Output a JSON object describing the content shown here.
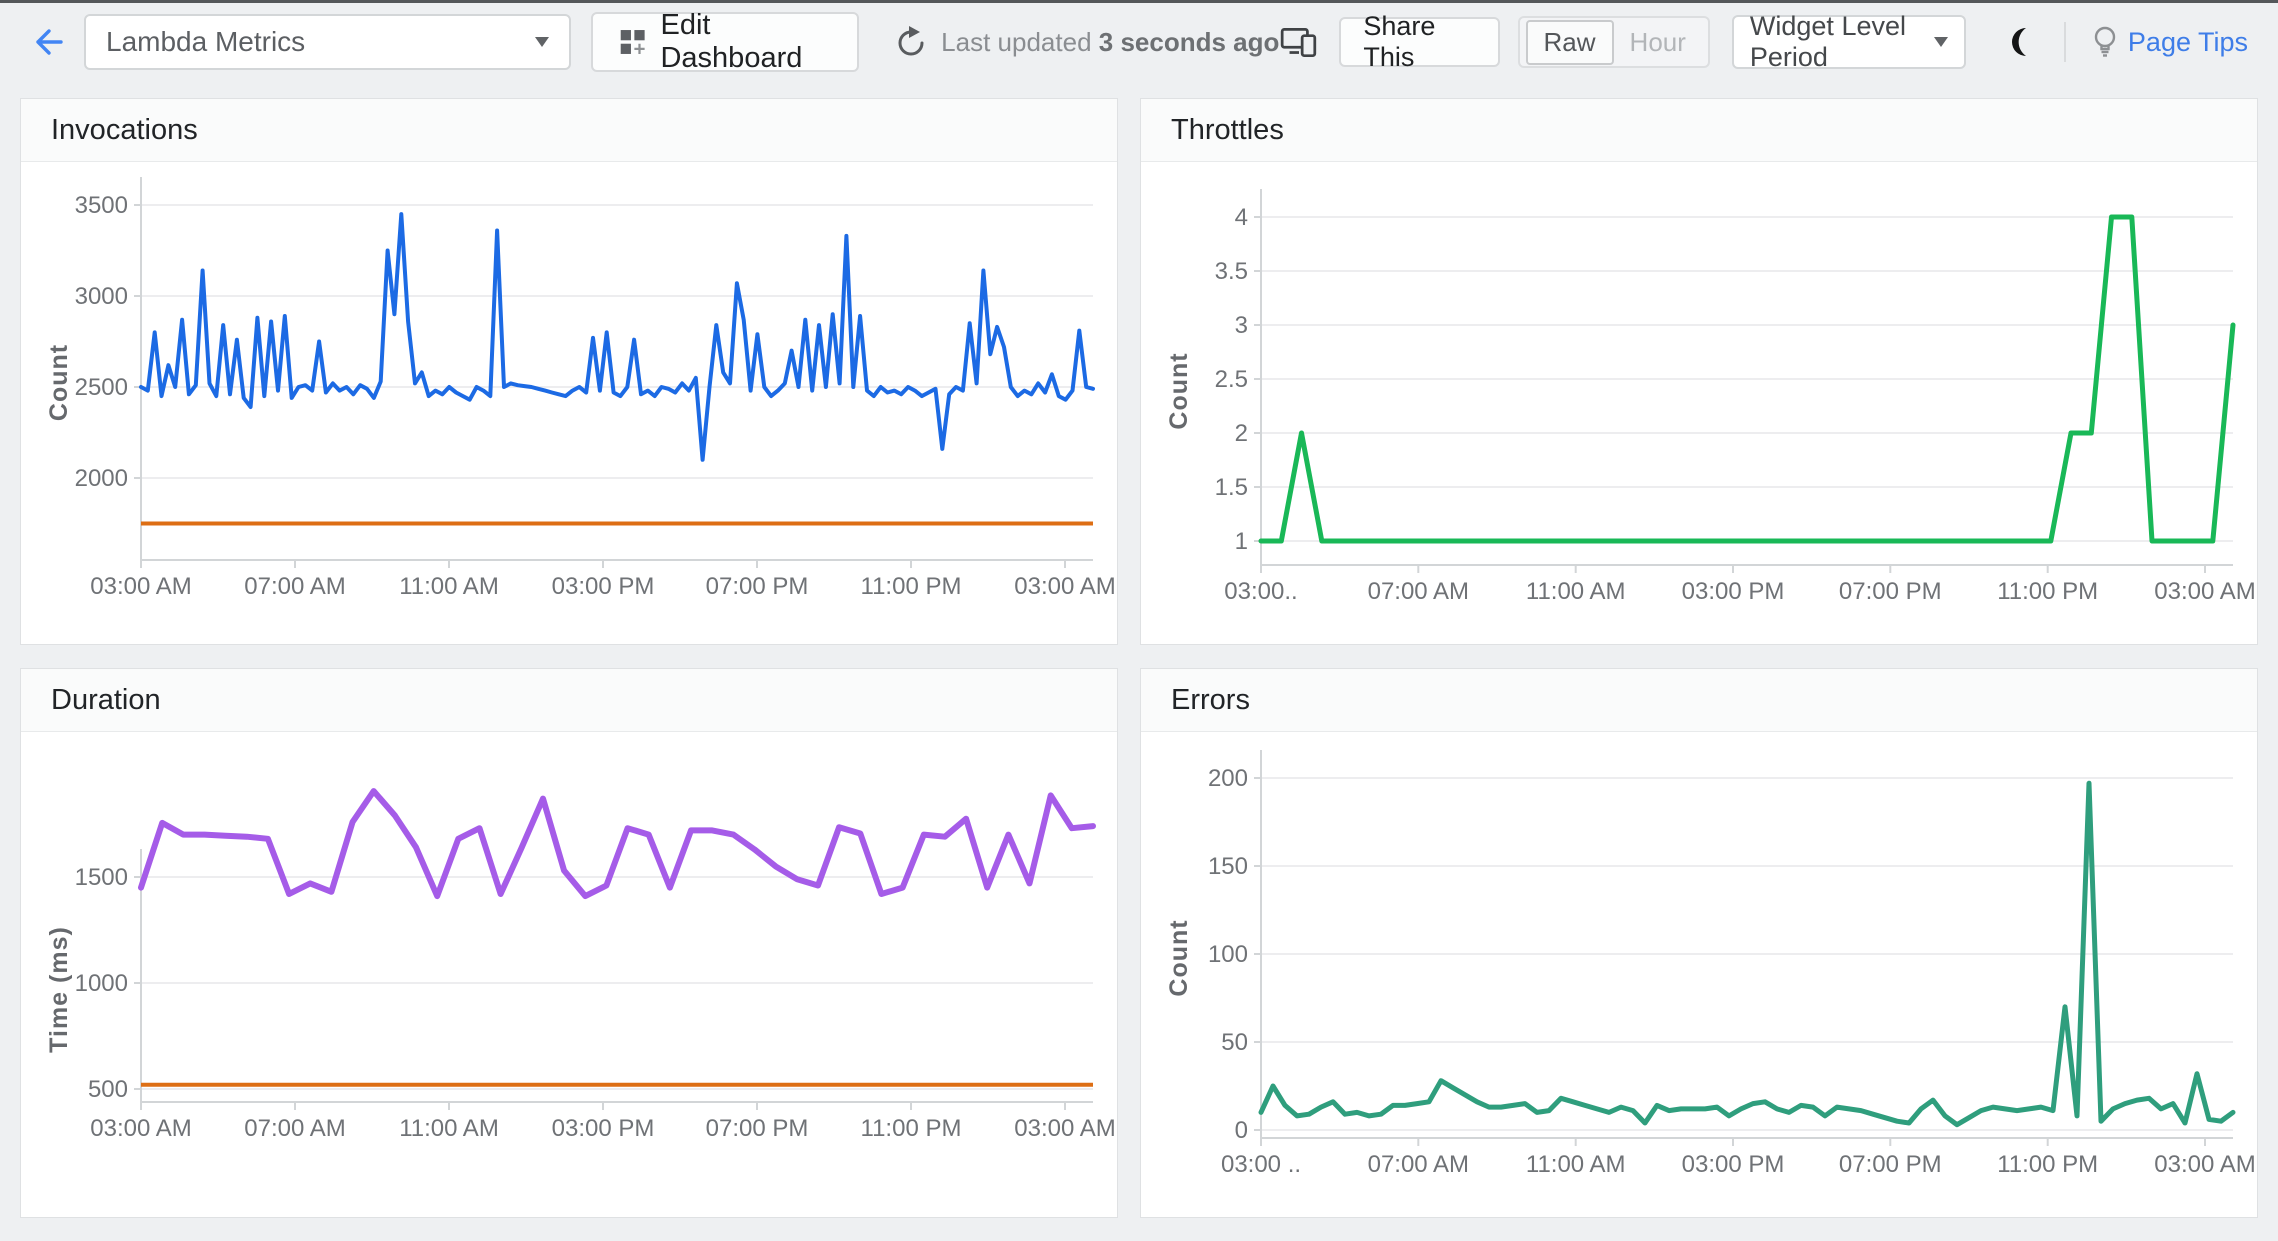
{
  "header": {
    "dashboard_select": {
      "value": "Lambda Metrics"
    },
    "edit_dashboard_label": "Edit Dashboard",
    "last_updated_prefix": "Last updated",
    "last_updated_value": "3 seconds ago",
    "share_label": "Share This",
    "granularity": {
      "options": [
        "Raw",
        "Hour"
      ],
      "selected": "Raw"
    },
    "period_select": {
      "value": "Widget Level Period"
    },
    "page_tips_label": "Page Tips",
    "icons": {
      "back": "arrow-left",
      "refresh": "refresh-arrow",
      "devices": "monitor-and-phone",
      "moon": "crescent-moon",
      "bulb": "lightbulb",
      "caret": "caret-down",
      "edit": "dashboard-grid-plus"
    }
  },
  "colors": {
    "accent_blue": "#4285f4",
    "link_blue": "#3e7de8",
    "line_blue": "#1c6ae4",
    "line_green": "#19b857",
    "line_purple": "#a55ce8",
    "line_teal": "#2f9e7d",
    "threshold_orange": "#dd6e14"
  },
  "chart_data": [
    {
      "type": "line",
      "title": "Invocations",
      "ylabel": "Count",
      "x_labels": [
        "03:00 AM",
        "07:00 AM",
        "11:00 AM",
        "03:00 PM",
        "07:00 PM",
        "11:00 PM",
        "03:00 AM"
      ],
      "y_ticks": [
        3500,
        3000,
        2500,
        2000
      ],
      "ylim": [
        1550,
        3500
      ],
      "grid": "horizontal",
      "legend": "none",
      "threshold": {
        "value": 1750,
        "color": "#dd6e14"
      },
      "series": [
        {
          "name": "Invocations",
          "color": "#1c6ae4",
          "values": [
            2500,
            2480,
            2800,
            2450,
            2620,
            2500,
            2870,
            2460,
            2510,
            3140,
            2520,
            2450,
            2840,
            2460,
            2760,
            2440,
            2390,
            2880,
            2450,
            2860,
            2480,
            2890,
            2440,
            2500,
            2510,
            2480,
            2750,
            2470,
            2520,
            2480,
            2500,
            2460,
            2510,
            2490,
            2440,
            2530,
            3250,
            2900,
            3450,
            2860,
            2520,
            2580,
            2450,
            2480,
            2460,
            2500,
            2470,
            2450,
            2430,
            2500,
            2480,
            2450,
            3360,
            2500,
            2520,
            2510,
            2505,
            2500,
            2490,
            2480,
            2470,
            2460,
            2450,
            2480,
            2500,
            2470,
            2770,
            2480,
            2800,
            2470,
            2450,
            2500,
            2760,
            2460,
            2480,
            2450,
            2500,
            2490,
            2470,
            2520,
            2480,
            2550,
            2100,
            2500,
            2840,
            2580,
            2520,
            3070,
            2870,
            2480,
            2790,
            2500,
            2450,
            2480,
            2520,
            2700,
            2500,
            2870,
            2480,
            2840,
            2500,
            2900,
            2520,
            3330,
            2500,
            2890,
            2480,
            2450,
            2500,
            2470,
            2480,
            2460,
            2500,
            2480,
            2450,
            2470,
            2490,
            2160,
            2460,
            2500,
            2480,
            2850,
            2520,
            3140,
            2680,
            2830,
            2720,
            2500,
            2450,
            2480,
            2460,
            2520,
            2470,
            2570,
            2450,
            2430,
            2480,
            2810,
            2500,
            2490
          ]
        }
      ]
    },
    {
      "type": "line",
      "title": "Throttles",
      "ylabel": "Count",
      "x_labels": [
        "03:00..",
        "07:00 AM",
        "11:00 AM",
        "03:00 PM",
        "07:00 PM",
        "11:00 PM",
        "03:00 AM"
      ],
      "y_ticks": [
        4,
        3.5,
        3,
        2.5,
        2,
        1.5,
        1
      ],
      "ylim": [
        0.8,
        4.2
      ],
      "grid": "horizontal",
      "legend": "none",
      "series": [
        {
          "name": "Throttles",
          "color": "#19b857",
          "values": [
            1,
            1,
            2,
            1,
            1,
            1,
            1,
            1,
            1,
            1,
            1,
            1,
            1,
            1,
            1,
            1,
            1,
            1,
            1,
            1,
            1,
            1,
            1,
            1,
            1,
            1,
            1,
            1,
            1,
            1,
            1,
            1,
            1,
            1,
            1,
            1,
            1,
            1,
            1,
            1,
            2,
            2,
            4,
            4,
            1,
            1,
            1,
            1,
            3
          ]
        }
      ]
    },
    {
      "type": "line",
      "title": "Duration",
      "ylabel": "Time (ms)",
      "x_labels": [
        "03:00 AM",
        "07:00 AM",
        "11:00 AM",
        "03:00 PM",
        "07:00 PM",
        "11:00 PM",
        "03:00 AM"
      ],
      "y_ticks": [
        1500,
        1000,
        500
      ],
      "ylim": [
        435,
        2185
      ],
      "grid": "horizontal",
      "legend": "none",
      "threshold": {
        "value": 520,
        "color": "#dd6e14"
      },
      "series": [
        {
          "name": "Duration",
          "color": "#a55ce8",
          "values": [
            1450,
            1755,
            1700,
            1700,
            1695,
            1690,
            1680,
            1420,
            1470,
            1430,
            1760,
            1905,
            1790,
            1640,
            1410,
            1680,
            1730,
            1420,
            1640,
            1870,
            1530,
            1410,
            1460,
            1730,
            1700,
            1450,
            1720,
            1720,
            1700,
            1630,
            1550,
            1490,
            1460,
            1735,
            1705,
            1420,
            1450,
            1700,
            1690,
            1775,
            1450,
            1700,
            1470,
            1885,
            1730,
            1740
          ]
        }
      ]
    },
    {
      "type": "line",
      "title": "Errors",
      "ylabel": "Count",
      "x_labels": [
        "03:00 ..",
        "07:00 AM",
        "11:00 AM",
        "03:00 PM",
        "07:00 PM",
        "11:00 PM",
        "03:00 AM"
      ],
      "y_ticks": [
        200,
        150,
        100,
        50,
        0
      ],
      "ylim": [
        0,
        205
      ],
      "grid": "horizontal",
      "legend": "none",
      "series": [
        {
          "name": "Errors",
          "color": "#2f9e7d",
          "values": [
            10,
            25,
            14,
            8,
            9,
            13,
            16,
            9,
            10,
            8,
            9,
            14,
            14,
            15,
            16,
            28,
            24,
            20,
            16,
            13,
            13,
            14,
            15,
            10,
            11,
            18,
            16,
            14,
            12,
            10,
            13,
            11,
            4,
            14,
            11,
            12,
            12,
            12,
            13,
            8,
            12,
            15,
            16,
            12,
            10,
            14,
            13,
            8,
            13,
            12,
            11,
            9,
            7,
            5,
            4,
            12,
            17,
            8,
            3,
            7,
            11,
            13,
            12,
            11,
            12,
            13,
            11,
            70,
            8,
            197,
            5,
            12,
            15,
            17,
            18,
            12,
            15,
            4,
            32,
            6,
            5,
            10
          ]
        }
      ]
    }
  ]
}
